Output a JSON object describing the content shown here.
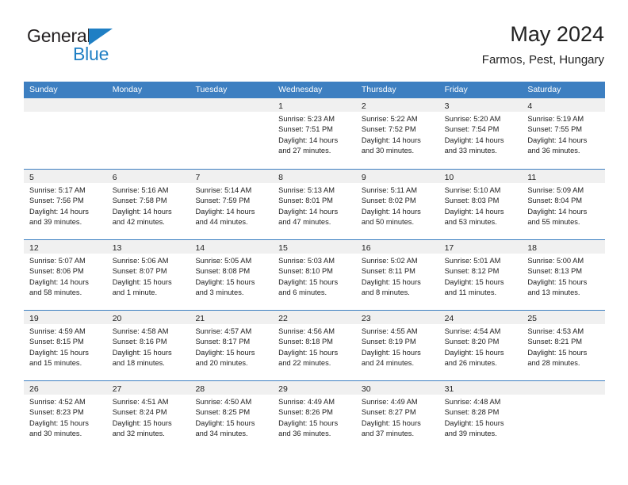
{
  "brand": {
    "name_part1": "General",
    "name_part2": "Blue",
    "triangle_color": "#1f7fc4",
    "text_color": "#231f20",
    "blue_color": "#1f7fc4"
  },
  "header": {
    "title": "May 2024",
    "subtitle": "Farmos, Pest, Hungary"
  },
  "theme": {
    "header_blue": "#3d7fc1",
    "day_band_gray": "#f0f0f0",
    "text_dark": "#222222"
  },
  "weekdays": [
    "Sunday",
    "Monday",
    "Tuesday",
    "Wednesday",
    "Thursday",
    "Friday",
    "Saturday"
  ],
  "weeks": [
    [
      {
        "day": "",
        "lines": []
      },
      {
        "day": "",
        "lines": []
      },
      {
        "day": "",
        "lines": []
      },
      {
        "day": "1",
        "lines": [
          "Sunrise: 5:23 AM",
          "Sunset: 7:51 PM",
          "Daylight: 14 hours",
          "and 27 minutes."
        ]
      },
      {
        "day": "2",
        "lines": [
          "Sunrise: 5:22 AM",
          "Sunset: 7:52 PM",
          "Daylight: 14 hours",
          "and 30 minutes."
        ]
      },
      {
        "day": "3",
        "lines": [
          "Sunrise: 5:20 AM",
          "Sunset: 7:54 PM",
          "Daylight: 14 hours",
          "and 33 minutes."
        ]
      },
      {
        "day": "4",
        "lines": [
          "Sunrise: 5:19 AM",
          "Sunset: 7:55 PM",
          "Daylight: 14 hours",
          "and 36 minutes."
        ]
      }
    ],
    [
      {
        "day": "5",
        "lines": [
          "Sunrise: 5:17 AM",
          "Sunset: 7:56 PM",
          "Daylight: 14 hours",
          "and 39 minutes."
        ]
      },
      {
        "day": "6",
        "lines": [
          "Sunrise: 5:16 AM",
          "Sunset: 7:58 PM",
          "Daylight: 14 hours",
          "and 42 minutes."
        ]
      },
      {
        "day": "7",
        "lines": [
          "Sunrise: 5:14 AM",
          "Sunset: 7:59 PM",
          "Daylight: 14 hours",
          "and 44 minutes."
        ]
      },
      {
        "day": "8",
        "lines": [
          "Sunrise: 5:13 AM",
          "Sunset: 8:01 PM",
          "Daylight: 14 hours",
          "and 47 minutes."
        ]
      },
      {
        "day": "9",
        "lines": [
          "Sunrise: 5:11 AM",
          "Sunset: 8:02 PM",
          "Daylight: 14 hours",
          "and 50 minutes."
        ]
      },
      {
        "day": "10",
        "lines": [
          "Sunrise: 5:10 AM",
          "Sunset: 8:03 PM",
          "Daylight: 14 hours",
          "and 53 minutes."
        ]
      },
      {
        "day": "11",
        "lines": [
          "Sunrise: 5:09 AM",
          "Sunset: 8:04 PM",
          "Daylight: 14 hours",
          "and 55 minutes."
        ]
      }
    ],
    [
      {
        "day": "12",
        "lines": [
          "Sunrise: 5:07 AM",
          "Sunset: 8:06 PM",
          "Daylight: 14 hours",
          "and 58 minutes."
        ]
      },
      {
        "day": "13",
        "lines": [
          "Sunrise: 5:06 AM",
          "Sunset: 8:07 PM",
          "Daylight: 15 hours",
          "and 1 minute."
        ]
      },
      {
        "day": "14",
        "lines": [
          "Sunrise: 5:05 AM",
          "Sunset: 8:08 PM",
          "Daylight: 15 hours",
          "and 3 minutes."
        ]
      },
      {
        "day": "15",
        "lines": [
          "Sunrise: 5:03 AM",
          "Sunset: 8:10 PM",
          "Daylight: 15 hours",
          "and 6 minutes."
        ]
      },
      {
        "day": "16",
        "lines": [
          "Sunrise: 5:02 AM",
          "Sunset: 8:11 PM",
          "Daylight: 15 hours",
          "and 8 minutes."
        ]
      },
      {
        "day": "17",
        "lines": [
          "Sunrise: 5:01 AM",
          "Sunset: 8:12 PM",
          "Daylight: 15 hours",
          "and 11 minutes."
        ]
      },
      {
        "day": "18",
        "lines": [
          "Sunrise: 5:00 AM",
          "Sunset: 8:13 PM",
          "Daylight: 15 hours",
          "and 13 minutes."
        ]
      }
    ],
    [
      {
        "day": "19",
        "lines": [
          "Sunrise: 4:59 AM",
          "Sunset: 8:15 PM",
          "Daylight: 15 hours",
          "and 15 minutes."
        ]
      },
      {
        "day": "20",
        "lines": [
          "Sunrise: 4:58 AM",
          "Sunset: 8:16 PM",
          "Daylight: 15 hours",
          "and 18 minutes."
        ]
      },
      {
        "day": "21",
        "lines": [
          "Sunrise: 4:57 AM",
          "Sunset: 8:17 PM",
          "Daylight: 15 hours",
          "and 20 minutes."
        ]
      },
      {
        "day": "22",
        "lines": [
          "Sunrise: 4:56 AM",
          "Sunset: 8:18 PM",
          "Daylight: 15 hours",
          "and 22 minutes."
        ]
      },
      {
        "day": "23",
        "lines": [
          "Sunrise: 4:55 AM",
          "Sunset: 8:19 PM",
          "Daylight: 15 hours",
          "and 24 minutes."
        ]
      },
      {
        "day": "24",
        "lines": [
          "Sunrise: 4:54 AM",
          "Sunset: 8:20 PM",
          "Daylight: 15 hours",
          "and 26 minutes."
        ]
      },
      {
        "day": "25",
        "lines": [
          "Sunrise: 4:53 AM",
          "Sunset: 8:21 PM",
          "Daylight: 15 hours",
          "and 28 minutes."
        ]
      }
    ],
    [
      {
        "day": "26",
        "lines": [
          "Sunrise: 4:52 AM",
          "Sunset: 8:23 PM",
          "Daylight: 15 hours",
          "and 30 minutes."
        ]
      },
      {
        "day": "27",
        "lines": [
          "Sunrise: 4:51 AM",
          "Sunset: 8:24 PM",
          "Daylight: 15 hours",
          "and 32 minutes."
        ]
      },
      {
        "day": "28",
        "lines": [
          "Sunrise: 4:50 AM",
          "Sunset: 8:25 PM",
          "Daylight: 15 hours",
          "and 34 minutes."
        ]
      },
      {
        "day": "29",
        "lines": [
          "Sunrise: 4:49 AM",
          "Sunset: 8:26 PM",
          "Daylight: 15 hours",
          "and 36 minutes."
        ]
      },
      {
        "day": "30",
        "lines": [
          "Sunrise: 4:49 AM",
          "Sunset: 8:27 PM",
          "Daylight: 15 hours",
          "and 37 minutes."
        ]
      },
      {
        "day": "31",
        "lines": [
          "Sunrise: 4:48 AM",
          "Sunset: 8:28 PM",
          "Daylight: 15 hours",
          "and 39 minutes."
        ]
      },
      {
        "day": "",
        "lines": []
      }
    ]
  ]
}
